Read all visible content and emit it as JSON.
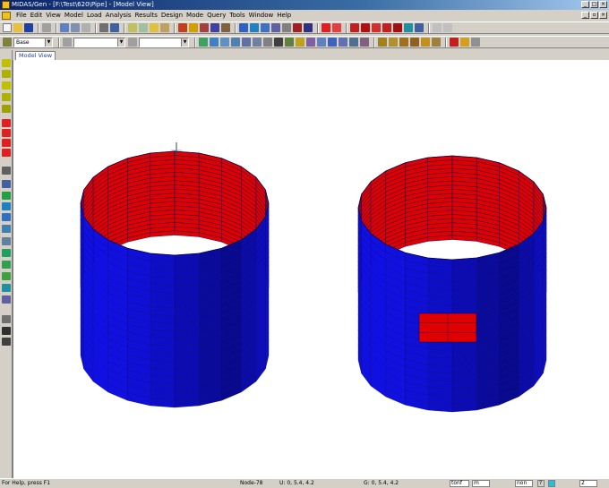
{
  "window": {
    "title": "MIDAS/Gen - [F:\\Test\\620\\Pipe] - [Model View]"
  },
  "menu": [
    "File",
    "Edit",
    "View",
    "Model",
    "Load",
    "Analysis",
    "Results",
    "Design",
    "Mode",
    "Query",
    "Tools",
    "Window",
    "Help"
  ],
  "toolbar": {
    "combo_base": "Base"
  },
  "tab": {
    "label": "Model View"
  },
  "colors": {
    "shell_outer": "#1010d0",
    "shell_inner": "#e00000",
    "mesh_line": "#000060",
    "patch": "#e00000"
  },
  "status": {
    "help": "For Help, press F1",
    "node": "Node-78",
    "ucs": "U: 0, 5.4, 4.2",
    "gcs": "G: 0, 5.4, 4.2",
    "unit_force": "tonf",
    "unit_length": "m",
    "filter": "non",
    "page_count": "2"
  }
}
